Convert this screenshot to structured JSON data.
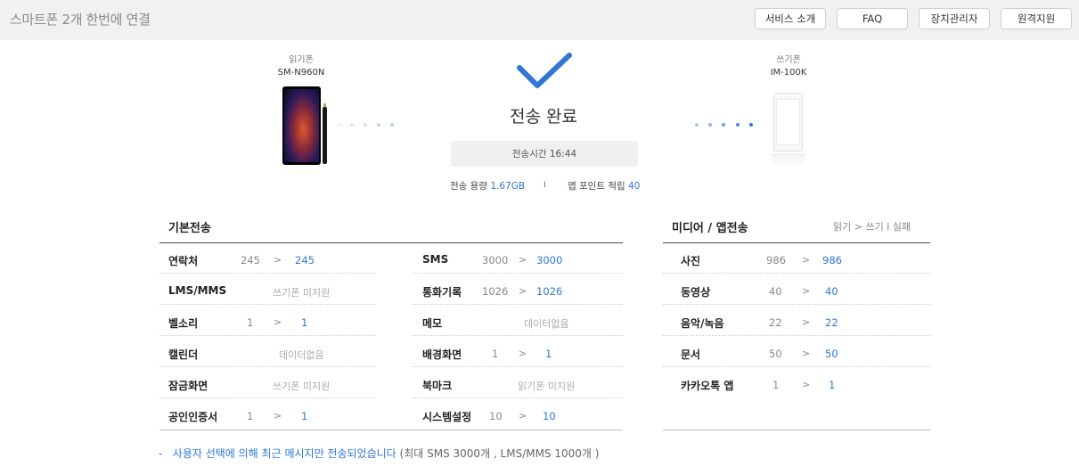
{
  "header": {
    "title": "스마트폰 2개 한번에 연결",
    "nav": [
      "서비스 소개",
      "FAQ",
      "장치관리자",
      "원격지원"
    ]
  },
  "source_phone": {
    "role": "읽기폰",
    "model": "SM-N960N"
  },
  "target_phone": {
    "role": "쓰기폰",
    "model": "IM-100K"
  },
  "status": {
    "title": "전송 완료",
    "time_text": "전송시간 16:44",
    "capacity_label": "전송 용량",
    "capacity_value": "1.67GB",
    "separator": "I",
    "points_label": "앱 포인트 적립",
    "points_value": "40"
  },
  "basic": {
    "title": "기본전송",
    "left": [
      {
        "name": "연락처",
        "from": "245",
        "gt": ">",
        "to": "245"
      },
      {
        "name": "LMS/MMS",
        "note": "쓰기폰 미지원"
      },
      {
        "name": "벨소리",
        "from": "1",
        "gt": ">",
        "to": "1"
      },
      {
        "name": "캘린더",
        "note": "데이터없음"
      },
      {
        "name": "잠금화면",
        "note": "쓰기폰 미지원"
      },
      {
        "name": "공인인증서",
        "from": "1",
        "gt": ">",
        "to": "1"
      }
    ],
    "right": [
      {
        "name": "SMS",
        "from": "3000",
        "gt": ">",
        "to": "3000"
      },
      {
        "name": "통화기록",
        "from": "1026",
        "gt": ">",
        "to": "1026"
      },
      {
        "name": "메모",
        "note": "데이터없음"
      },
      {
        "name": "배경화면",
        "from": "1",
        "gt": ">",
        "to": "1"
      },
      {
        "name": "북마크",
        "note": "읽기폰 미지원"
      },
      {
        "name": "시스템설정",
        "from": "10",
        "gt": ">",
        "to": "10"
      }
    ]
  },
  "media": {
    "title": "미디어 / 앱전송",
    "legend": "읽기  >  쓰기   I   실패",
    "rows": [
      {
        "name": "사진",
        "from": "986",
        "gt": ">",
        "to": "986"
      },
      {
        "name": "동영상",
        "from": "40",
        "gt": ">",
        "to": "40"
      },
      {
        "name": "음악/녹음",
        "from": "22",
        "gt": ">",
        "to": "22"
      },
      {
        "name": "문서",
        "from": "50",
        "gt": ">",
        "to": "50"
      },
      {
        "name": "카카오톡 앱",
        "from": "1",
        "gt": ">",
        "to": "1"
      }
    ]
  },
  "footnote": {
    "dash": "-",
    "main": "사용자 선택에 의해 최근 메시지만 전송되었습니다",
    "paren": "(최대 SMS 3000개 , LMS/MMS 1000개 )"
  },
  "colors": {
    "accent": "#2f76d6",
    "check": "#2f76d6"
  }
}
